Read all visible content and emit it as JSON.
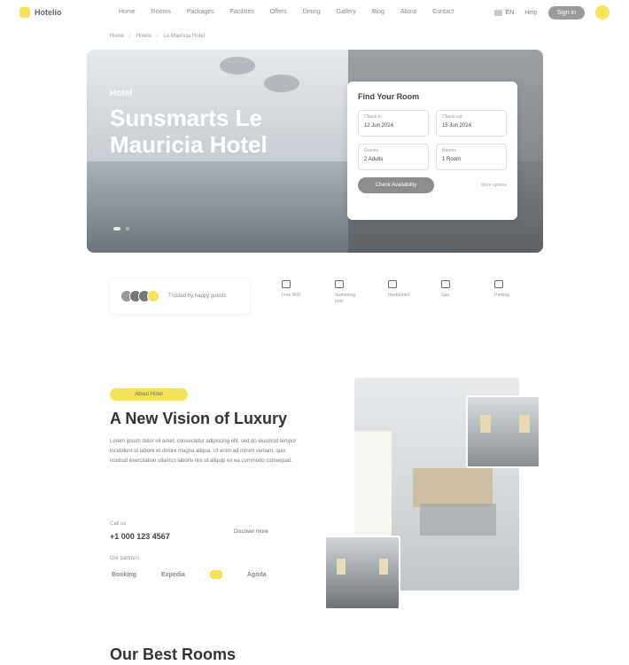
{
  "nav": {
    "logo": "Hotelio",
    "items": [
      "Home",
      "Rooms",
      "Packages",
      "Facilities",
      "Offers",
      "Dining",
      "Gallery",
      "Blog",
      "About",
      "Contact"
    ],
    "language": "EN",
    "help": "Help",
    "signin": "Sign in"
  },
  "breadcrumb": [
    "Home",
    "Hotels",
    "Le Mauricia Hotel"
  ],
  "hero": {
    "subtitle": "Hotel",
    "title": "Sunsmarts Le Mauricia Hotel"
  },
  "booking": {
    "title": "Find Your Room",
    "checkin_label": "Check-in",
    "checkin_value": "12 Jun 2024",
    "checkout_label": "Check-out",
    "checkout_value": "15 Jun 2024",
    "guests_label": "Guests",
    "guests_value": "2 Adults",
    "rooms_label": "Rooms",
    "rooms_value": "1 Room",
    "button": "Check Availability",
    "link": "More options"
  },
  "rating": {
    "text": "Trusted by happy guests"
  },
  "features": [
    {
      "icon": "wifi-icon",
      "label": "Free WiFi"
    },
    {
      "icon": "pool-icon",
      "label": "Swimming pool"
    },
    {
      "icon": "restaurant-icon",
      "label": "Restaurant"
    },
    {
      "icon": "spa-icon",
      "label": "Spa"
    },
    {
      "icon": "parking-icon",
      "label": "Parking"
    }
  ],
  "about": {
    "tag": "About Hotel",
    "title": "A New Vision of Luxury",
    "text": "Lorem ipsum dolor sit amet, consectetur adipiscing elit, sed do eiusmod tempor incididunt ut labore et dolore magna aliqua. Ut enim ad minim veniam, quis nostrud exercitation ullamco laboris nisi ut aliquip ex ea commodo consequat.",
    "call_label": "Call us",
    "call_number": "+1 000 123 4567",
    "discover": "Discover more",
    "partners_label": "Our partners",
    "partners": [
      "Booking",
      "Expedia",
      "Agoda"
    ]
  },
  "rooms": {
    "title": "Our Best Rooms"
  }
}
